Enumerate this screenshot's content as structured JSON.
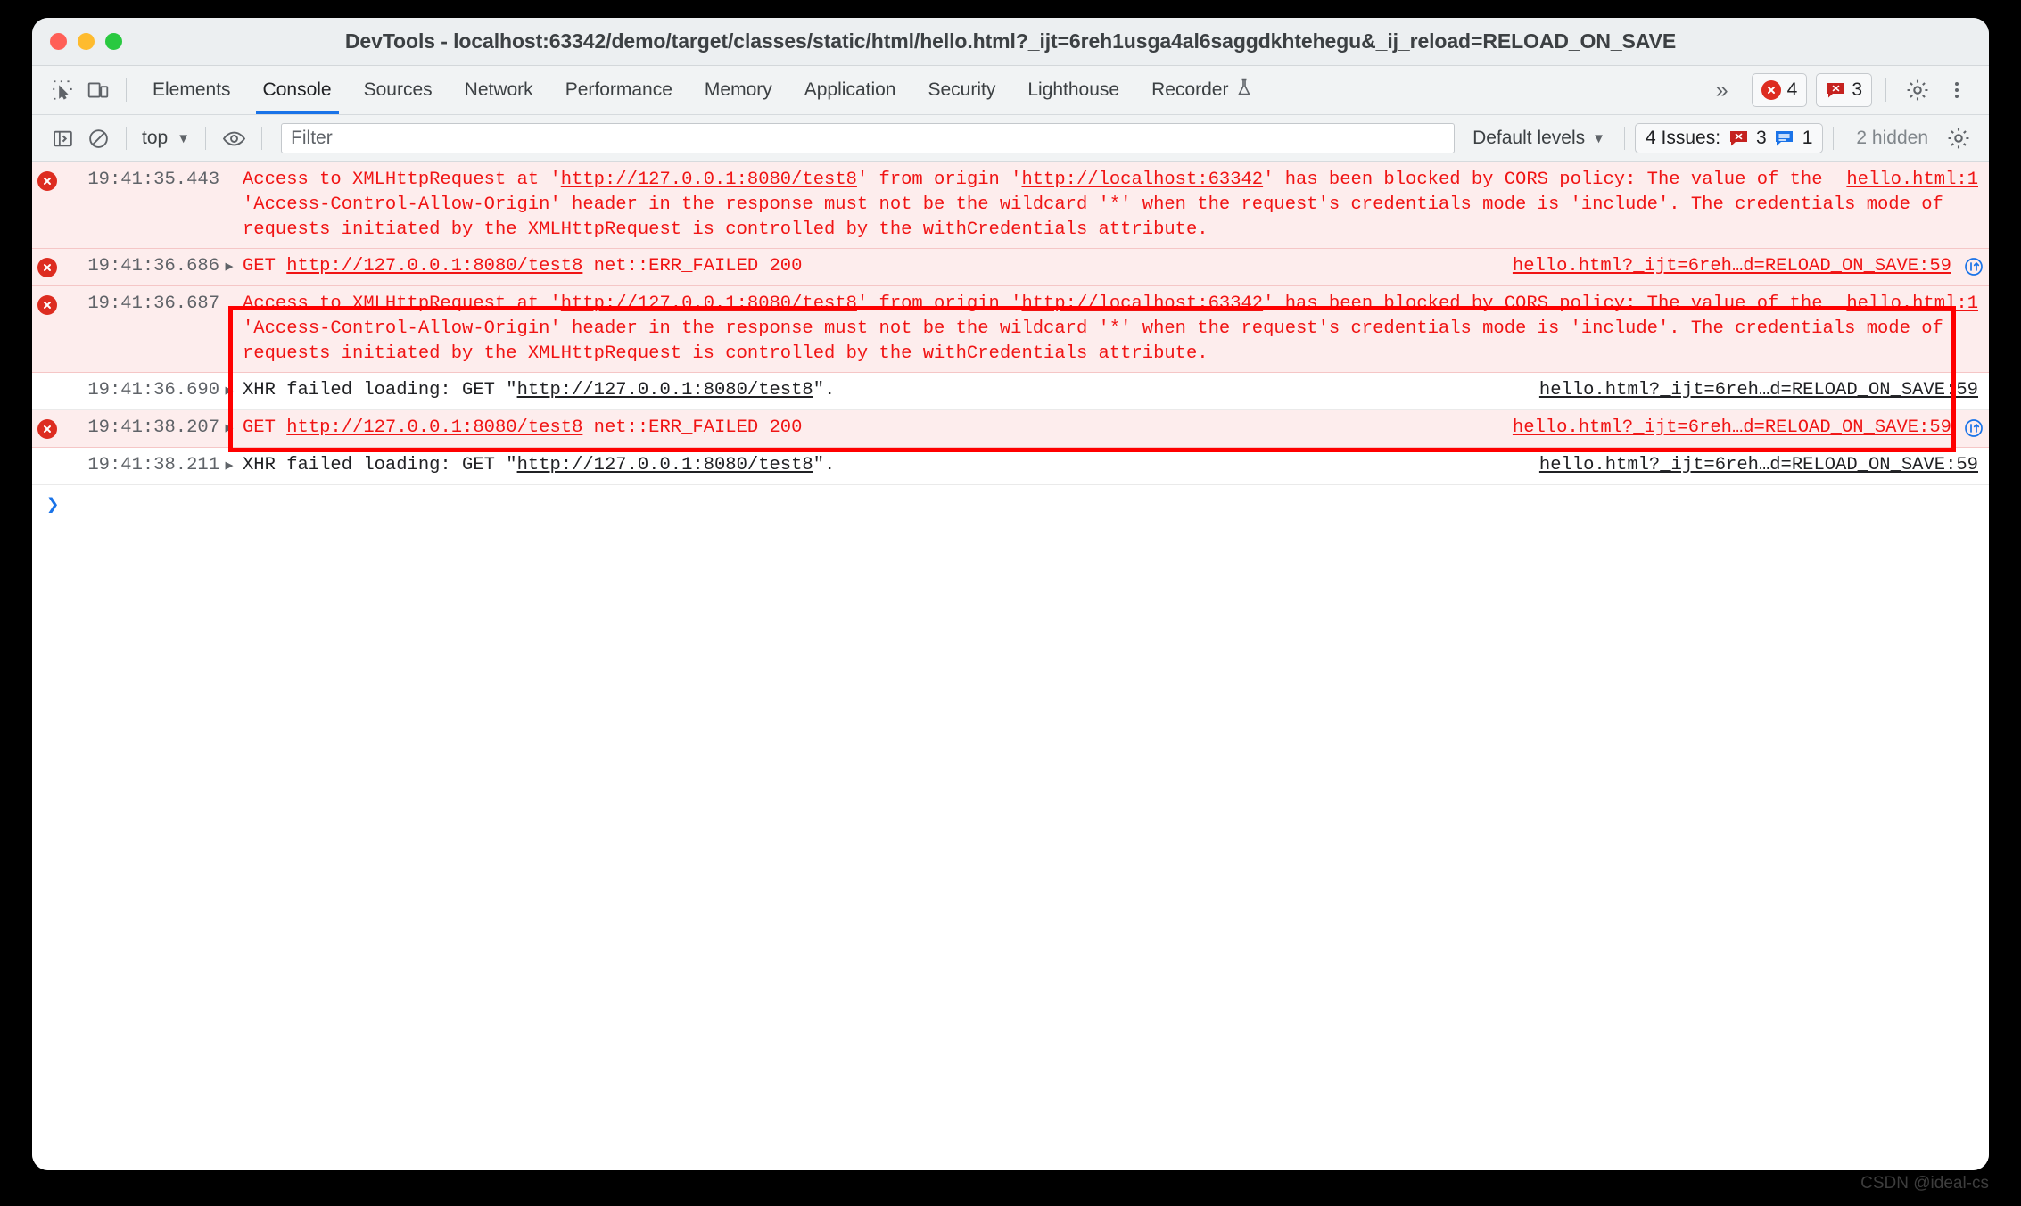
{
  "window": {
    "title": "DevTools - localhost:63342/demo/target/classes/static/html/hello.html?_ijt=6reh1usga4al6saggdkhtehegu&_ij_reload=RELOAD_ON_SAVE"
  },
  "tabstrip": {
    "icons": {
      "inspect": "inspect-element-icon",
      "device": "device-toolbar-icon",
      "more": "more-tabs-chevrons",
      "settings": "gear-icon",
      "kebab": "more-options-icon"
    },
    "tabs": [
      {
        "label": "Elements",
        "active": false
      },
      {
        "label": "Console",
        "active": true
      },
      {
        "label": "Sources",
        "active": false
      },
      {
        "label": "Network",
        "active": false
      },
      {
        "label": "Performance",
        "active": false
      },
      {
        "label": "Memory",
        "active": false
      },
      {
        "label": "Application",
        "active": false
      },
      {
        "label": "Security",
        "active": false
      },
      {
        "label": "Lighthouse",
        "active": false
      },
      {
        "label": "Recorder",
        "active": false,
        "icon": "flask-icon"
      }
    ],
    "more_label": "»",
    "error_count": "4",
    "issue_count": "3"
  },
  "filterbar": {
    "sidebar_toggle": "console-sidebar-icon",
    "clear_console": "clear-console-icon",
    "context": "top",
    "caret": "▼",
    "eye_icon": "live-expression-eye-icon",
    "filter_placeholder": "Filter",
    "filter_value": "",
    "levels_label": "Default levels",
    "issues_label": "4 Issues:",
    "issues_error_count": "3",
    "issues_info_count": "1",
    "hidden_label": "2 hidden",
    "settings_icon": "gear-icon"
  },
  "console": {
    "messages": [
      {
        "level": "error",
        "timestamp": "19:41:35.443",
        "has_icon": true,
        "has_disclosure": false,
        "text_parts": [
          {
            "t": "Access to XMLHttpRequest at '",
            "link": false
          },
          {
            "t": "http://127.0.0.1:8080/test8",
            "link": true
          },
          {
            "t": "' from origin '",
            "link": false
          },
          {
            "t": "http://localhost:63342",
            "link": true
          },
          {
            "t": "' has been blocked by CORS policy: The value of the 'Access-Control-Allow-Origin' header in the response must not be the wildcard '*' when the request's credentials mode is 'include'. The credentials mode of requests initiated by the XMLHttpRequest is controlled by the withCredentials attribute.",
            "link": false
          }
        ],
        "source": "hello.html:1",
        "net_icon": false
      },
      {
        "level": "error",
        "timestamp": "19:41:36.686",
        "has_icon": true,
        "has_disclosure": true,
        "text_parts": [
          {
            "t": "GET ",
            "link": false
          },
          {
            "t": "http://127.0.0.1:8080/test8",
            "link": true
          },
          {
            "t": " net::ERR_FAILED 200",
            "link": false
          }
        ],
        "source": "hello.html?_ijt=6reh…d=RELOAD_ON_SAVE:59",
        "net_icon": true
      },
      {
        "level": "error",
        "timestamp": "19:41:36.687",
        "has_icon": true,
        "has_disclosure": false,
        "text_parts": [
          {
            "t": "Access to XMLHttpRequest at '",
            "link": false
          },
          {
            "t": "http://127.0.0.1:8080/test8",
            "link": true
          },
          {
            "t": "' from origin '",
            "link": false
          },
          {
            "t": "http://localhost:63342",
            "link": true
          },
          {
            "t": "' has been blocked by CORS policy: The value of the 'Access-Control-Allow-Origin' header in the response must not be the wildcard '*' when the request's credentials mode is 'include'. The credentials mode of requests initiated by the XMLHttpRequest is controlled by the withCredentials attribute.",
            "link": false
          }
        ],
        "source": "hello.html:1",
        "net_icon": false
      },
      {
        "level": "plain",
        "timestamp": "19:41:36.690",
        "has_icon": false,
        "has_disclosure": true,
        "text_parts": [
          {
            "t": "XHR failed loading: GET \"",
            "link": false
          },
          {
            "t": "http://127.0.0.1:8080/test8",
            "link": true
          },
          {
            "t": "\".",
            "link": false
          }
        ],
        "source": "hello.html?_ijt=6reh…d=RELOAD_ON_SAVE:59",
        "net_icon": false
      },
      {
        "level": "error",
        "timestamp": "19:41:38.207",
        "has_icon": true,
        "has_disclosure": true,
        "text_parts": [
          {
            "t": "GET ",
            "link": false
          },
          {
            "t": "http://127.0.0.1:8080/test8",
            "link": true
          },
          {
            "t": " net::ERR_FAILED 200",
            "link": false
          }
        ],
        "source": "hello.html?_ijt=6reh…d=RELOAD_ON_SAVE:59",
        "net_icon": true
      },
      {
        "level": "plain",
        "timestamp": "19:41:38.211",
        "has_icon": false,
        "has_disclosure": true,
        "text_parts": [
          {
            "t": "XHR failed loading: GET \"",
            "link": false
          },
          {
            "t": "http://127.0.0.1:8080/test8",
            "link": true
          },
          {
            "t": "\".",
            "link": false
          }
        ],
        "source": "hello.html?_ijt=6reh…d=RELOAD_ON_SAVE:59",
        "net_icon": false
      }
    ],
    "prompt_chevron": "❯"
  },
  "annotation": {
    "color": "#ff0000"
  },
  "watermark": "CSDN @ideal-cs"
}
